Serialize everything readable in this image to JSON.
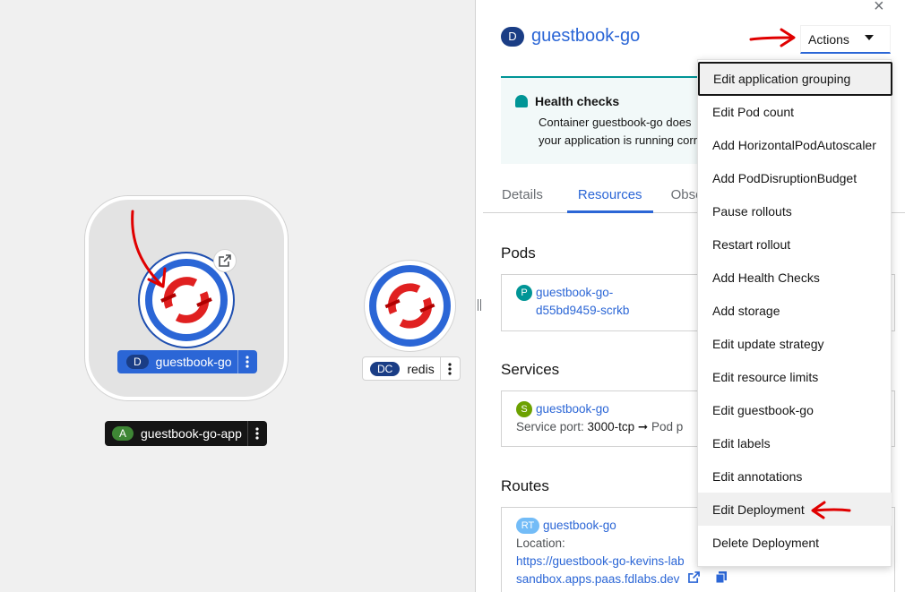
{
  "topology": {
    "deployment_node": {
      "badge": "D",
      "label": "guestbook-go"
    },
    "redis_node": {
      "badge": "DC",
      "label": "redis"
    },
    "application_group": {
      "badge": "A",
      "label": "guestbook-go-app"
    }
  },
  "panel": {
    "close_icon": "×",
    "title_badge": "D",
    "title": "guestbook-go",
    "actions_label": "Actions",
    "health_alert": {
      "title": "Health checks",
      "text_line1": "Container guestbook-go does",
      "text_line2": "your application is running corr"
    },
    "tabs": [
      {
        "label": "Details"
      },
      {
        "label": "Resources"
      },
      {
        "label": "Obse"
      }
    ],
    "pods": {
      "heading": "Pods",
      "badge": "P",
      "name_line1": "guestbook-go-",
      "name_line2": "d55bd9459-scrkb"
    },
    "services": {
      "heading": "Services",
      "badge": "S",
      "name": "guestbook-go",
      "port_label": "Service port:",
      "port_value": "3000-tcp",
      "arrow": "➞",
      "pod_text": "Pod p"
    },
    "routes": {
      "heading": "Routes",
      "badge": "RT",
      "name": "guestbook-go",
      "location_label": "Location:",
      "url_line1": "https://guestbook-go-kevins-lab",
      "url_line2": "sandbox.apps.paas.fdlabs.dev"
    }
  },
  "actions_menu": {
    "items": [
      "Edit application grouping",
      "Edit Pod count",
      "Add HorizontalPodAutoscaler",
      "Add PodDisruptionBudget",
      "Pause rollouts",
      "Restart rollout",
      "Add Health Checks",
      "Add storage",
      "Edit update strategy",
      "Edit resource limits",
      "Edit guestbook-go",
      "Edit labels",
      "Edit annotations",
      "Edit Deployment",
      "Delete Deployment"
    ]
  },
  "colors": {
    "accent": "#2b66d6",
    "badge_deployment": "#1a3d85",
    "badge_app": "#3e8635",
    "badge_pod": "#009596",
    "badge_service": "#6ca100",
    "badge_route": "#73bcf7",
    "annotation": "#e00000"
  }
}
